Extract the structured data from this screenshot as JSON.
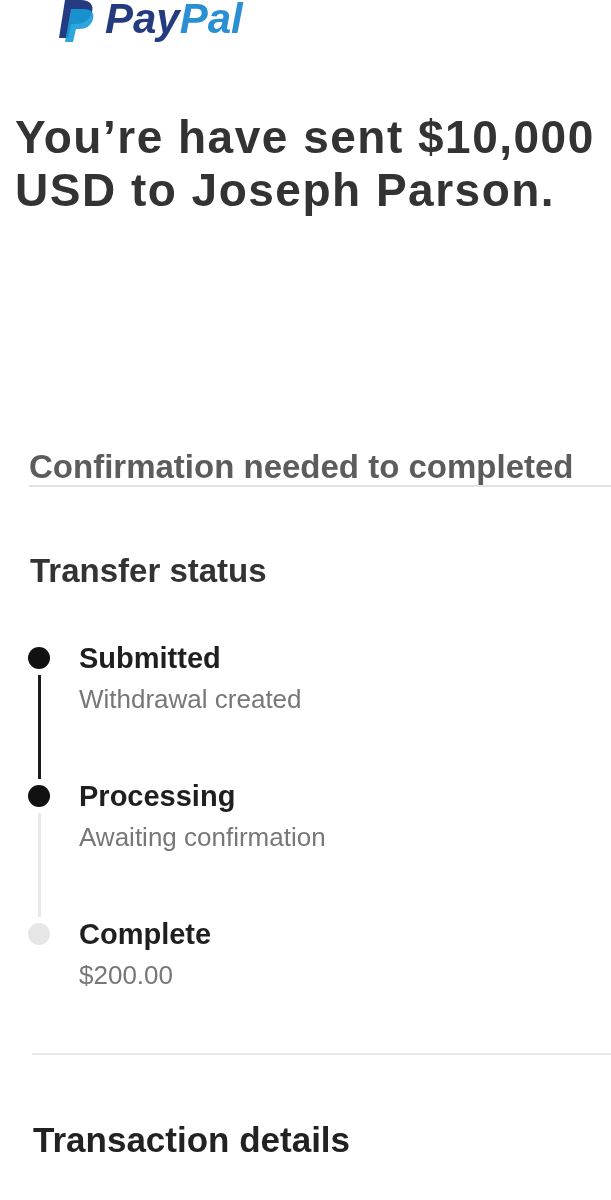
{
  "logo": {
    "parts": [
      {
        "text": "Pay",
        "color": "#253b80"
      },
      {
        "text": "Pal",
        "color": "#2a8fd3"
      }
    ]
  },
  "headline": "You’re have sent $10,000 USD to Joseph Parson.",
  "notice": "Confirmation needed to completed",
  "transfer_status": {
    "title": "Transfer status",
    "steps": [
      {
        "title": "Submitted",
        "detail": "Withdrawal created",
        "done": true
      },
      {
        "title": "Processing",
        "detail": "Awaiting confirmation",
        "done": true
      },
      {
        "title": "Complete",
        "detail": "$200.00",
        "done": false
      }
    ]
  },
  "transaction_details": {
    "title": "Transaction details"
  }
}
